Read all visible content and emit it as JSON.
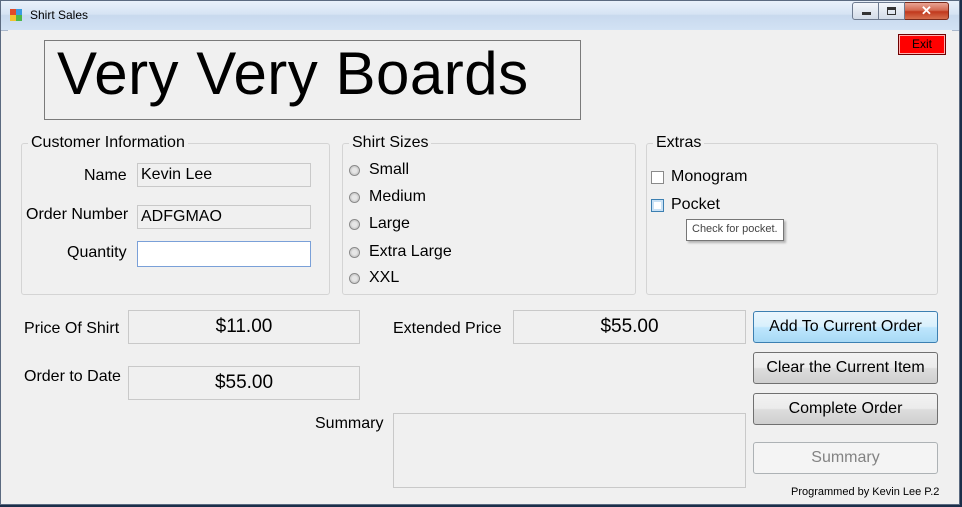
{
  "window": {
    "title": "Shirt Sales"
  },
  "exit_button": "Exit",
  "logo": "Very Very Boards",
  "customer": {
    "title": "Customer Information",
    "name_label": "Name",
    "name_value": "Kevin Lee",
    "order_label": "Order Number",
    "order_value": "ADFGMAO",
    "quantity_label": "Quantity",
    "quantity_value": ""
  },
  "sizes": {
    "title": "Shirt Sizes",
    "options": [
      "Small",
      "Medium",
      "Large",
      "Extra Large",
      "XXL"
    ]
  },
  "extras": {
    "title": "Extras",
    "options": [
      "Monogram",
      "Pocket"
    ],
    "tooltip": "Check for pocket."
  },
  "pricing": {
    "price_label": "Price Of Shirt",
    "price_value": "$11.00",
    "to_date_label": "Order to Date",
    "to_date_value": "$55.00",
    "extended_label": "Extended Price",
    "extended_value": "$55.00",
    "summary_label": "Summary"
  },
  "buttons": {
    "add": "Add To Current Order",
    "clear": "Clear the Current Item",
    "complete": "Complete Order",
    "summary": "Summary"
  },
  "credit": "Programmed by Kevin Lee P.2"
}
